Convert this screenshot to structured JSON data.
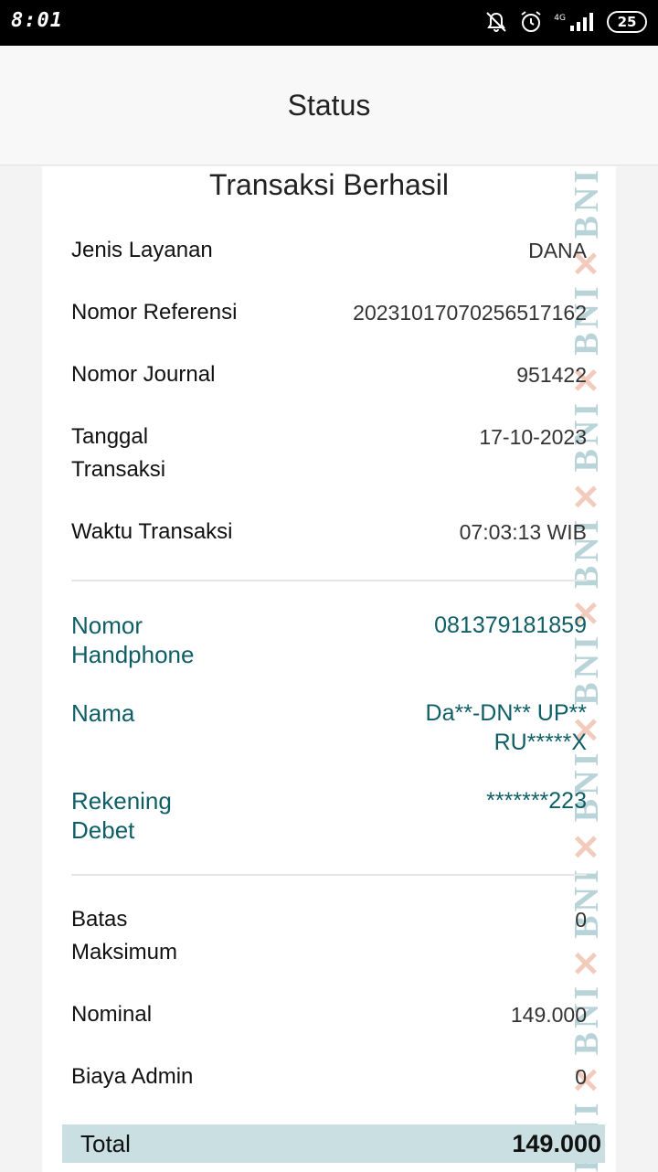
{
  "status_bar": {
    "time": "8:01",
    "network_label": "4G",
    "battery": "25",
    "icons": [
      "bell-off-icon",
      "alarm-icon",
      "signal-icon",
      "battery-icon"
    ]
  },
  "header": {
    "title": "Status"
  },
  "card": {
    "title": "Transaksi Berhasil",
    "watermark": "BNI",
    "details": [
      {
        "label": "Jenis Layanan",
        "value": "DANA"
      },
      {
        "label": "Nomor Referensi",
        "value": "20231017070256517162"
      },
      {
        "label": "Nomor Journal",
        "value": "951422"
      },
      {
        "label": "Tanggal Transaksi",
        "value": "17-10-2023"
      },
      {
        "label": "Waktu Transaksi",
        "value": "07:03:13 WIB"
      }
    ],
    "account": [
      {
        "label": "Nomor Handphone",
        "value": "081379181859"
      },
      {
        "label": "Nama",
        "value": "Da**-DN** UP** RU*****X"
      },
      {
        "label": "Rekening Debet",
        "value": "*******223"
      }
    ],
    "amounts": [
      {
        "label": "Batas Maksimum",
        "value": "0"
      },
      {
        "label": "Nominal",
        "value": "149.000"
      },
      {
        "label": "Biaya Admin",
        "value": "0"
      }
    ],
    "total": {
      "label": "Total",
      "value": "149.000"
    }
  },
  "colors": {
    "accent": "#0f5e66",
    "total_bg": "#c9dfe1",
    "watermark_teal": "#b9d4d8",
    "watermark_orange": "#f3cbbd"
  }
}
